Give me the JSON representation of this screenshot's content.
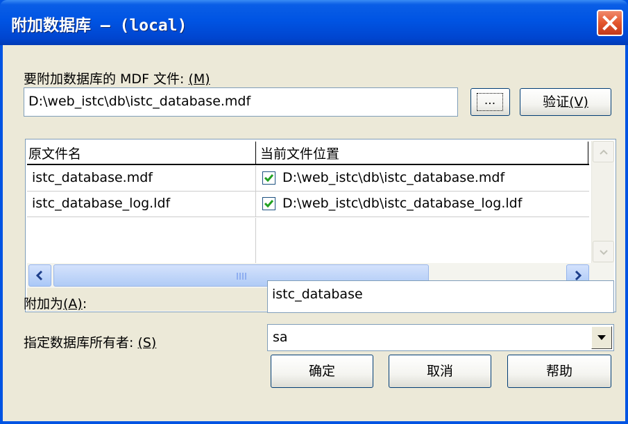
{
  "window": {
    "title": "附加数据库 — (local)",
    "close_label": "×"
  },
  "mdf": {
    "label": "要附加数据库的 MDF 文件: ",
    "mnemonic": "(M)",
    "path": "D:\\web_istc\\db\\istc_database.mdf",
    "browse_label": "...",
    "verify_label": "验证",
    "verify_mnemonic": "(V)"
  },
  "files_grid": {
    "columns": [
      "原文件名",
      "当前文件位置"
    ],
    "rows": [
      {
        "original": "istc_database.mdf",
        "checked": true,
        "current": "D:\\web_istc\\db\\istc_database.mdf"
      },
      {
        "original": "istc_database_log.ldf",
        "checked": true,
        "current": "D:\\web_istc\\db\\istc_database_log.ldf"
      }
    ]
  },
  "attach_as": {
    "label": "附加为",
    "mnemonic": "(A)",
    "colon": ":",
    "value": "istc_database"
  },
  "owner": {
    "label": "指定数据库所有者: ",
    "mnemonic": "(S)",
    "value": "sa"
  },
  "buttons": {
    "ok": "确定",
    "cancel": "取消",
    "help": "帮助"
  },
  "colors": {
    "titlebar": "#0054e3",
    "dialog_bg": "#ece9d8",
    "close_button": "#e3562d",
    "checkbox_check": "#21a121"
  }
}
